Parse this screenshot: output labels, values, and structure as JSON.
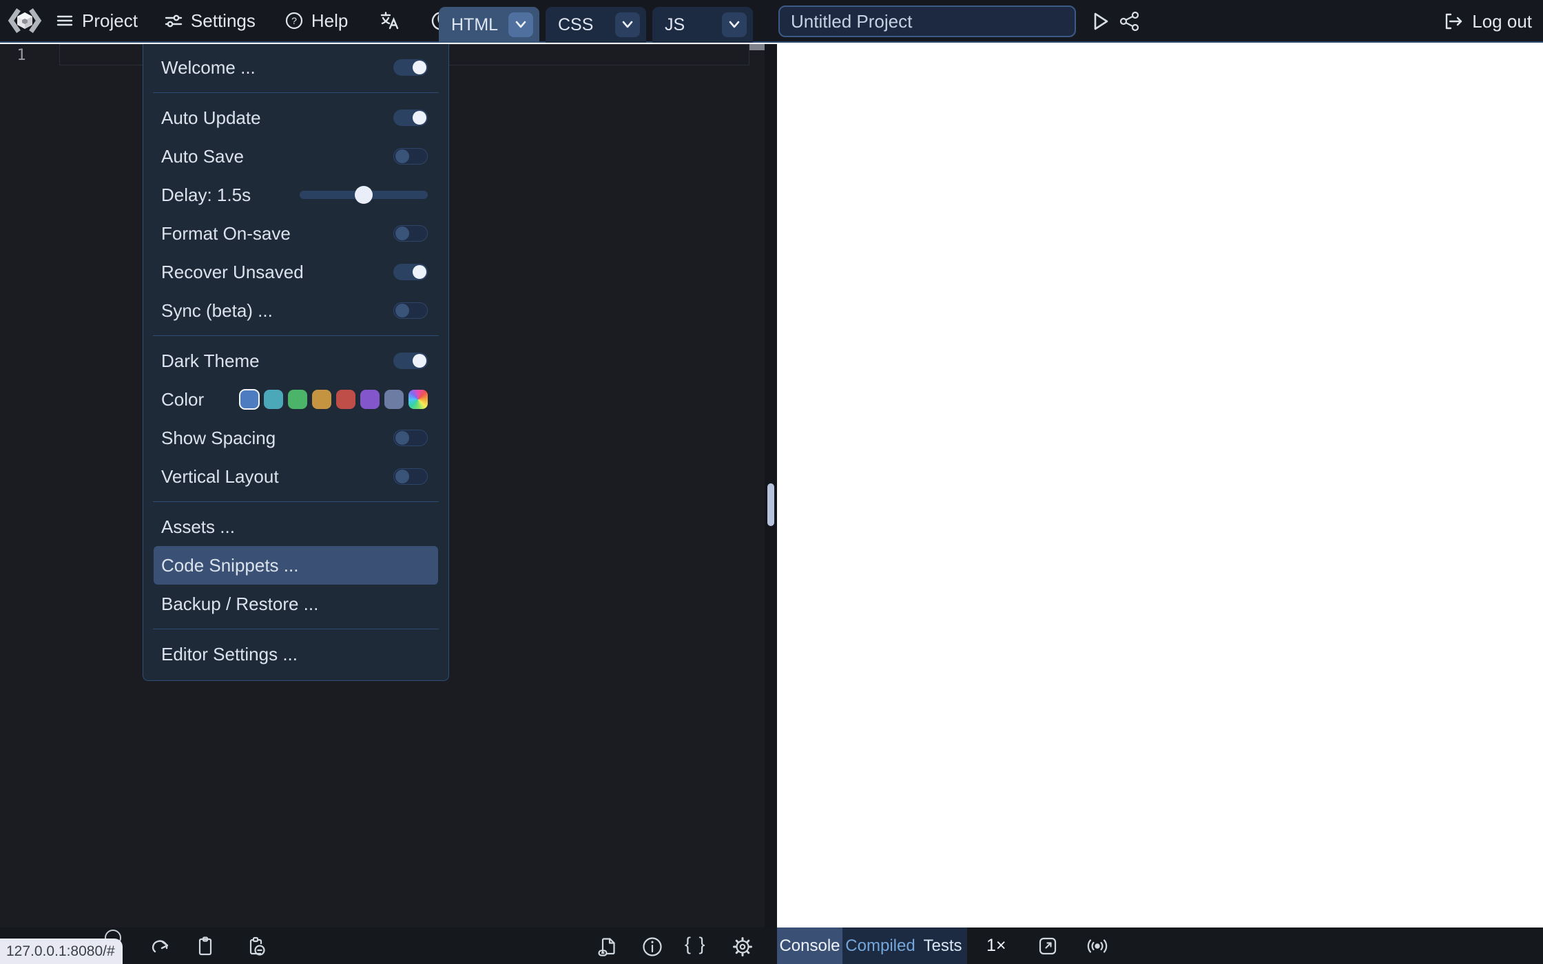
{
  "header": {
    "menus": [
      {
        "label": "Project",
        "icon": "hamburger-icon"
      },
      {
        "label": "Settings",
        "icon": "sliders-icon"
      },
      {
        "label": "Help",
        "icon": "help-circle-icon"
      }
    ],
    "tool_icons": [
      "translate-icon",
      "dark-mode-moon-icon"
    ],
    "editor_tabs": [
      {
        "label": "HTML",
        "active": true
      },
      {
        "label": "CSS",
        "active": false
      },
      {
        "label": "JS",
        "active": false
      }
    ],
    "project_name": {
      "value": "Untitled Project"
    },
    "logout_label": "Log out"
  },
  "settings_menu": {
    "sections": [
      {
        "items": [
          {
            "label": "Welcome ...",
            "control": "toggle",
            "state": "on"
          }
        ]
      },
      {
        "items": [
          {
            "label": "Auto Update",
            "control": "toggle",
            "state": "on"
          },
          {
            "label": "Auto Save",
            "control": "toggle",
            "state": "off"
          },
          {
            "label": "Delay: 1.5s",
            "control": "slider",
            "value_percent": 50
          },
          {
            "label": "Format On-save",
            "control": "toggle",
            "state": "off"
          },
          {
            "label": "Recover Unsaved",
            "control": "toggle",
            "state": "on"
          },
          {
            "label": "Sync (beta) ...",
            "control": "toggle",
            "state": "off"
          }
        ]
      },
      {
        "items": [
          {
            "label": "Dark Theme",
            "control": "toggle",
            "state": "on"
          },
          {
            "label": "Color",
            "control": "swatches"
          },
          {
            "label": "Show Spacing",
            "control": "toggle",
            "state": "off"
          },
          {
            "label": "Vertical Layout",
            "control": "toggle",
            "state": "off"
          }
        ]
      },
      {
        "items": [
          {
            "label": "Assets ...",
            "control": "none"
          },
          {
            "label": "Code Snippets ...",
            "control": "none",
            "highlighted": true
          },
          {
            "label": "Backup / Restore ...",
            "control": "none"
          }
        ]
      },
      {
        "items": [
          {
            "label": "Editor Settings ...",
            "control": "none"
          }
        ]
      }
    ],
    "swatch_colors": [
      "#4d7cc1",
      "#4aa8b8",
      "#4cb468",
      "#c49440",
      "#c04e48",
      "#8356cc",
      "#6d7ca3",
      "conic-rainbow"
    ],
    "selected_swatch_index": 0
  },
  "editor": {
    "line_number": "1"
  },
  "statusbar": {
    "url_preview": "127.0.0.1:8080/#"
  },
  "editor_footer": {
    "braces_label": "{ }"
  },
  "console_bar": {
    "tabs": [
      {
        "label": "Console",
        "active": true
      },
      {
        "label": "Compiled",
        "active": false
      },
      {
        "label": "Tests",
        "active": false
      }
    ],
    "zoom_label": "1×"
  },
  "colors": {
    "accent_highlight": "#3a5175",
    "tab_active": "#3a5578",
    "tab_inactive": "#1d2b42",
    "header_bg": "#15181e",
    "menu_bg": "#1f2a39",
    "header_underline": "#2c4a70"
  }
}
